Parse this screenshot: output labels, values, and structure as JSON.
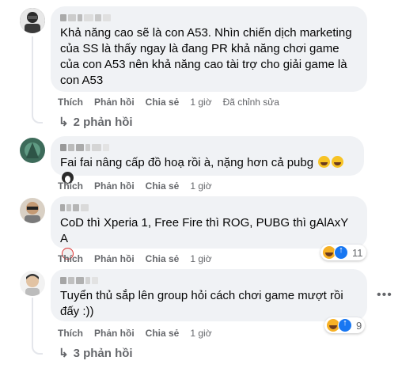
{
  "comments": [
    {
      "text": "Khả năng cao sẽ là con A53. Nhìn chiến dịch marketing của SS là thấy ngay là đang PR khả năng chơi game của con A53 nên khả năng cao tài trợ cho giải game là con A53",
      "actions": {
        "like": "Thích",
        "reply": "Phản hồi",
        "share": "Chia sẻ"
      },
      "time": "1 giờ",
      "edited": "Đã chỉnh sửa",
      "replies": "2 phản hồi"
    },
    {
      "text": "Fai fai nâng cấp đồ hoạ rồi à, nặng hơn cả pubg",
      "actions": {
        "like": "Thích",
        "reply": "Phản hồi",
        "share": "Chia sẻ"
      },
      "time": "1 giờ"
    },
    {
      "text": "CoD thì Xperia 1, Free Fire thì ROG, PUBG thì gAlAxY A",
      "actions": {
        "like": "Thích",
        "reply": "Phản hồi",
        "share": "Chia sẻ"
      },
      "time": "1 giờ",
      "reaction_count": "11"
    },
    {
      "text": "Tuyển thủ sắp lên group hỏi cách chơi game mượt rồi đấy :))",
      "actions": {
        "like": "Thích",
        "reply": "Phản hồi",
        "share": "Chia sẻ"
      },
      "time": "1 giờ",
      "reaction_count": "9",
      "replies": "3 phản hồi"
    }
  ],
  "icons": {
    "reply_arrow": "reply-arrow-icon",
    "more": "more-options-icon",
    "reaction_haha": "haha-reaction-icon",
    "reaction_like": "like-reaction-icon"
  },
  "colors": {
    "bubble": "#f0f2f5",
    "meta_text": "#65676b",
    "like_blue": "#1877f2",
    "haha_yellow": "#f7b125"
  }
}
